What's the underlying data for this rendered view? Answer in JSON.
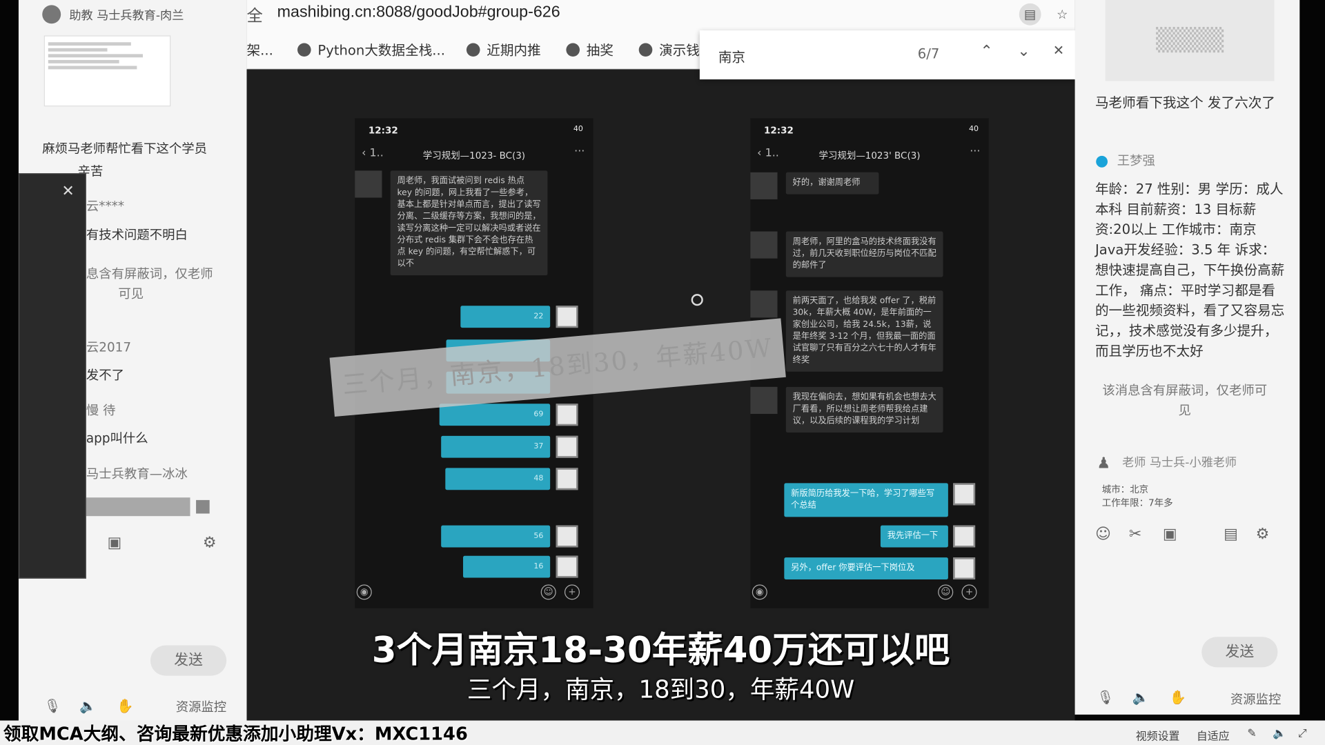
{
  "left_panel": {
    "header_name": "助教  马士兵教育-肉兰",
    "message_1": "麻烦马老师帮忙看下这个学员",
    "message_1b": "辛苦",
    "user_1": "云****",
    "message_2": "有技术问题不明白",
    "blocked_notice_line1": "息含有屏蔽词，仅老师",
    "blocked_notice_line2": "可见",
    "user_2": "云2017",
    "message_3": "发不了",
    "user_3": "慢 待",
    "message_4": "app叫什么",
    "user_4": "马士兵教育—冰冰",
    "send_label": "发送",
    "resource_monitor": "资源监控"
  },
  "browser": {
    "url_prefix": "全",
    "url": "mashibing.cn:8088/goodJob#group-626",
    "bookmarks": [
      "架...",
      "Python大数据全栈...",
      "近期内推",
      "抽奖",
      "演示钱"
    ],
    "find": {
      "query": "南京",
      "count": "6/7"
    }
  },
  "phone_left": {
    "time": "12:32",
    "status": "40",
    "title": "学习规划—1023-    BC(3)",
    "incoming": "周老师，我面试被问到 redis 热点 key 的问题，网上我看了一些参考，基本上都是针对单点而言，提出了读写分离、二级缓存等方案，我想问的是，读写分离这种一定可以解决吗或者说在分布式 redis 集群下会不会也存在热点 key 的问题，有空帮忙解惑下，可以不",
    "voice_durations": [
      "22",
      "",
      "",
      "69",
      "37",
      "48",
      "56",
      "16"
    ]
  },
  "phone_right": {
    "time": "12:32",
    "status": "40",
    "title": "学习规划—1023'    BC(3)",
    "msg_1": "好的，谢谢周老师",
    "msg_2": "周老师，阿里的盒马的技术终面我没有过，前几天收到职位经历与岗位不匹配的邮件了",
    "msg_3": "前两天面了，也给我发 offer 了，税前 30k，年薪大概 40W，是年前面的一家创业公司，给我 24.5k，13薪，说是年终奖 3-12 个月，但我最一面的面试官聊了只有百分之六七十的人才有年终奖",
    "msg_4": "我现在偏向去，想如果有机会也想去大厂看看，所以想让周老师帮我给点建议，以及后续的课程我的学习计划",
    "reply_1": "新版简历给我发一下哈，学习了哪些写个总结",
    "reply_2": "我先评估一下",
    "reply_3": "另外，offer 你要评估一下岗位及"
  },
  "overlay_banner": "三个月，南京，18到30，年薪40W",
  "right_panel": {
    "message_1": "马老师看下我这个 发了六次了",
    "user": "王梦强",
    "profile_text": "年龄：27 性别：男 学历：成人本科 目前薪资：13 目标薪资:20以上 工作城市：南京 Java开发经验：3.5   年 诉求：想快速提高自己，下午换份高薪工作，  痛点：平时学习都是看的一些视频资料，看了又容易忘记，，技术感觉没有多少提升，而且学历也不太好",
    "blocked_notice": "该消息含有屏蔽词，仅老师可见",
    "teacher": "老师  马士兵-小雅老师",
    "city": "城市：北京",
    "years": "工作年限：7年多",
    "send_label": "发送",
    "resource_monitor": "资源监控"
  },
  "captions": {
    "main": "3个月南京18-30年薪40万还可以吧",
    "sub": "三个月，南京，18到30，年薪40W"
  },
  "footer": {
    "ad": "领取MCA大纲、咨询最新优惠添加小助理Vx：MXC1146",
    "video_settings": "视频设置",
    "auto_fit": "自适应"
  }
}
